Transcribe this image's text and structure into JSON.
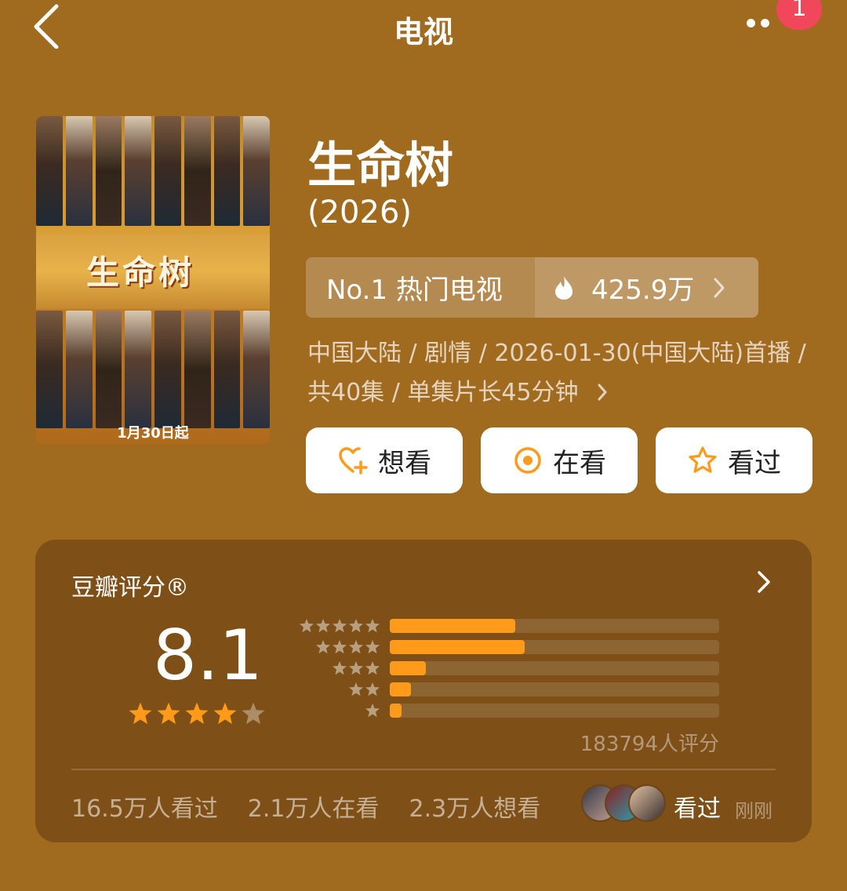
{
  "header": {
    "title": "电视",
    "badge_count": "1"
  },
  "poster": {
    "calligraphy": "生命树",
    "release_note": "1月30日起"
  },
  "show": {
    "title": "生命树",
    "year": "(2026)",
    "rank_label": "No.1 热门电视",
    "heat": "425.9万",
    "meta": "中国大陆 / 剧情 / 2026-01-30(中国大陆)首播 / 共40集 / 单集片长45分钟"
  },
  "actions": [
    {
      "label": "想看",
      "icon": "heart-plus-icon"
    },
    {
      "label": "在看",
      "icon": "target-circle-icon"
    },
    {
      "label": "看过",
      "icon": "star-outline-icon"
    }
  ],
  "rating": {
    "title": "豆瓣评分®",
    "score": "8.1",
    "stars_filled": 4,
    "stars_total": 5,
    "distribution": [
      {
        "stars": 5,
        "fraction": 0.38
      },
      {
        "stars": 4,
        "fraction": 0.41
      },
      {
        "stars": 3,
        "fraction": 0.11
      },
      {
        "stars": 2,
        "fraction": 0.065
      },
      {
        "stars": 1,
        "fraction": 0.035
      }
    ],
    "count_text": "183794人评分",
    "seen": "16.5万人看过",
    "watching": "2.1万人在看",
    "want": "2.3万人想看",
    "friend_action": "看过",
    "friend_time": "刚刚"
  },
  "colors": {
    "background": "#a06a1f",
    "accent": "#ff9a1a",
    "badge": "#f0485a",
    "star_empty": "rgba(255,255,255,0.35)"
  }
}
